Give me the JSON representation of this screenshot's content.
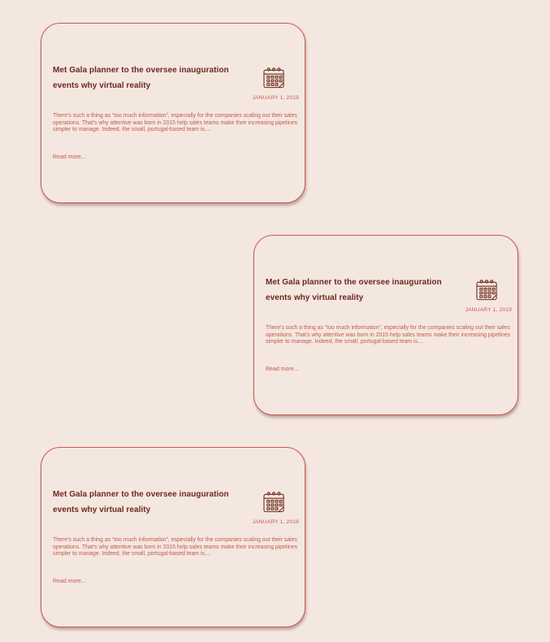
{
  "posts": [
    {
      "title": "Met Gala planner to the oversee inauguration events why virtual reality",
      "date": "JANUARY 1, 2019",
      "excerpt": "There's such a thing as “too much information”, especially for the companies scaling out their sales operations. That's why attentive was born in 2015 help sales teams make their increasing pipelines simpler to manage. Indeed, the small, portugal-based team is....",
      "read_more": "Read more...",
      "icon": "calendar-icon"
    },
    {
      "title": "Met Gala planner to the oversee inauguration events why virtual reality",
      "date": "JANUARY 1, 2019",
      "excerpt": "There's such a thing as “too much information”, especially for the companies scaling out their sales operations. That's why attentive was born in 2015 help sales teams make their increasing pipelines simpler to manage. Indeed, the small, portugal-based team is....",
      "read_more": "Read more...",
      "icon": "calendar-icon"
    },
    {
      "title": "Met Gala planner to the oversee inauguration events why virtual reality",
      "date": "JANUARY 1, 2019",
      "excerpt": "There's such a thing as “too much information”, especially for the companies scaling out their sales operations. That's why attentive was born in 2015 help sales teams make their increasing pipelines simpler to manage. Indeed, the small, portugal-based team is....",
      "read_more": "Read more...",
      "icon": "calendar-icon"
    }
  ],
  "colors": {
    "background": "#f4e7e0",
    "accent": "#c25b4c",
    "title": "#6a2a1c"
  }
}
